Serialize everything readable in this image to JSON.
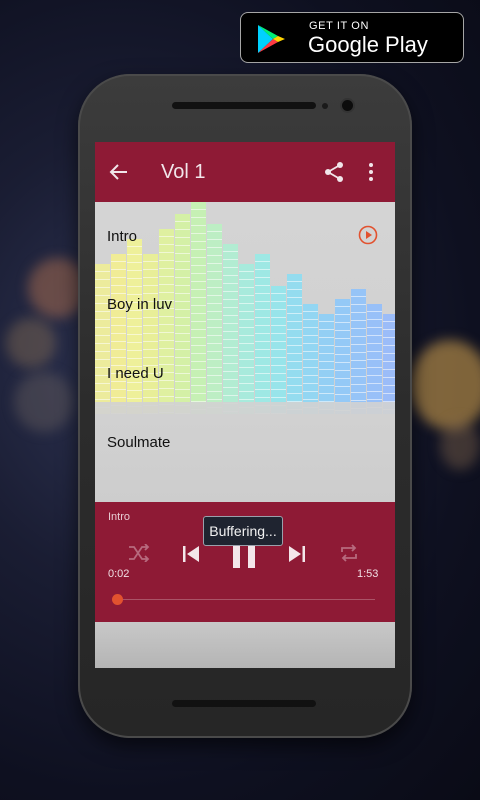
{
  "store_badge": {
    "line1": "GET IT ON",
    "line2": "Google Play"
  },
  "app": {
    "title": "Vol 1",
    "tracks": [
      "Intro",
      "Boy in luv",
      "I need U",
      "Soulmate"
    ]
  },
  "player": {
    "now_playing": "Intro",
    "elapsed": "0:02",
    "duration": "1:53",
    "progress": 0.02,
    "toast": "Buffering..."
  },
  "colors": {
    "toolbar": "#8e1a35",
    "accent": "#e2522f"
  },
  "icons": {
    "back": "arrow-left-icon",
    "share": "share-icon",
    "menu": "more-vert-icon",
    "track_play": "play-circle-icon",
    "shuffle": "shuffle-icon",
    "previous": "skip-previous-icon",
    "pause": "pause-icon",
    "next": "skip-next-icon",
    "repeat": "repeat-icon"
  }
}
